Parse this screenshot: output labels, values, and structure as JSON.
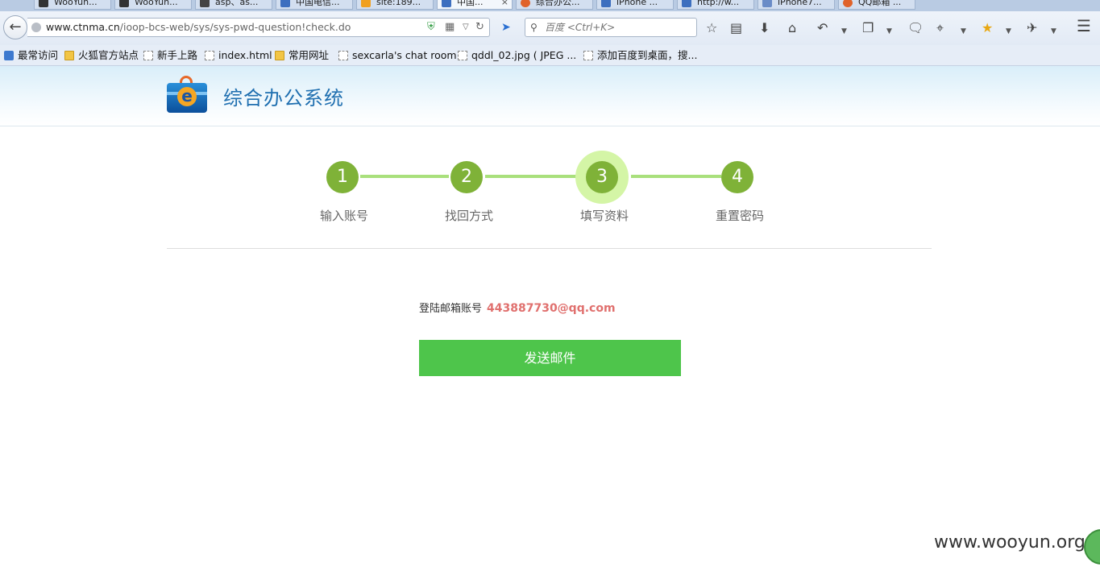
{
  "browser": {
    "tabs": [
      {
        "label": "WooYun...",
        "color": "#333333"
      },
      {
        "label": "WooYun...",
        "color": "#333333"
      },
      {
        "label": "asp、as...",
        "color": "#444444"
      },
      {
        "label": "中国电信...",
        "color": "#3d6fbf"
      },
      {
        "label": "site:189...",
        "color": "#f0a020"
      },
      {
        "label": "中国...",
        "color": "#3d6fbf",
        "active": true
      },
      {
        "label": "综合办公...",
        "color": "#e0622a"
      },
      {
        "label": "iPhone ...",
        "color": "#3d6fbf"
      },
      {
        "label": "http://w...",
        "color": "#3d6fbf"
      },
      {
        "label": "iPhone7...",
        "color": "#6a8cc7"
      },
      {
        "label": "QQ邮箱 ...",
        "color": "#e0622a"
      }
    ],
    "tab_close": "×",
    "url_domain": "www.ctnma.cn",
    "url_path": "/ioop-bcs-web/sys/sys-pwd-question!check.do",
    "search_placeholder": "百度 <Ctrl+K>",
    "bookmarks": [
      {
        "label": "最常访问",
        "icon": "blue"
      },
      {
        "label": "火狐官方站点",
        "icon": "folder"
      },
      {
        "label": "新手上路",
        "icon": "page"
      },
      {
        "label": "index.html",
        "icon": "page"
      },
      {
        "label": "常用网址",
        "icon": "folder"
      },
      {
        "label": "sexcarla's chat room",
        "icon": "page"
      },
      {
        "label": "qddl_02.jpg ( JPEG ...",
        "icon": "page"
      },
      {
        "label": "添加百度到桌面，搜...",
        "icon": "page"
      }
    ]
  },
  "page": {
    "title": "综合办公系统",
    "steps": [
      {
        "number": "1",
        "label": "输入账号"
      },
      {
        "number": "2",
        "label": "找回方式"
      },
      {
        "number": "3",
        "label": "填写资料"
      },
      {
        "number": "4",
        "label": "重置密码"
      }
    ],
    "current_step": 3,
    "email_label": "登陆邮箱账号",
    "email_value": "443887730@qq.com",
    "send_button": "发送邮件",
    "accent_color": "#4ec54b",
    "step_color": "#7fb238"
  },
  "watermark": "www.wooyun.org"
}
